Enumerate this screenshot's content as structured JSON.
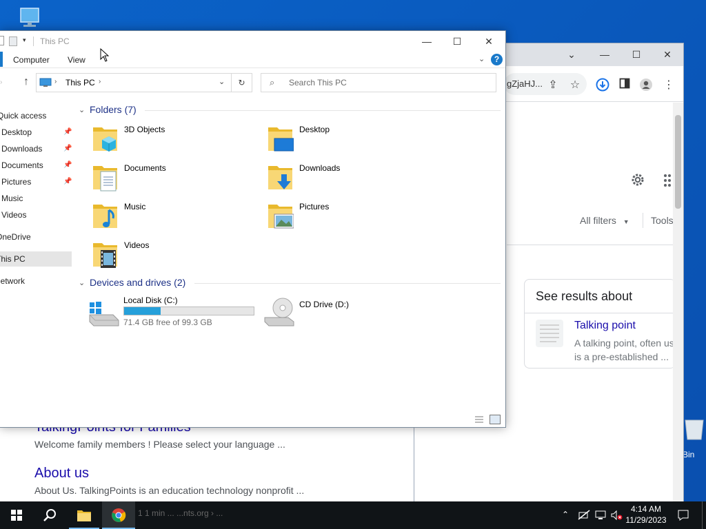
{
  "desktop": {
    "recycle_bin_partial": "Bin"
  },
  "chrome": {
    "address_fragment": "gZjaHJ...",
    "filters": {
      "all_filters": "All filters",
      "tools": "Tools"
    },
    "knowledge_panel": {
      "heading": "See results about",
      "item_title": "Talking point",
      "item_desc_line1": "A talking point, often us",
      "item_desc_line2": "is a pre-established ..."
    },
    "results": [
      {
        "title": "TalkingPoints for Families",
        "snippet": "Welcome family members ! Please select your language ..."
      },
      {
        "title": "About us",
        "snippet": "About Us. TalkingPoints is an education technology nonprofit ..."
      }
    ],
    "partial_bottom_text": "1 1 min ... ...nts.org › ..."
  },
  "explorer": {
    "title": "This PC",
    "ribbon_tabs": [
      "Computer",
      "View"
    ],
    "address": {
      "path": "This PC"
    },
    "search_placeholder": "Search This PC",
    "nav": {
      "quick_access": "Quick access",
      "items": [
        "Desktop",
        "Downloads",
        "Documents",
        "Pictures",
        "Music",
        "Videos"
      ],
      "onedrive": "OneDrive",
      "this_pc": "This PC",
      "network": "Network"
    },
    "folders_header": "Folders (7)",
    "folders": [
      "3D Objects",
      "Desktop",
      "Documents",
      "Downloads",
      "Music",
      "Pictures",
      "Videos"
    ],
    "devices_header": "Devices and drives (2)",
    "drives": [
      {
        "name": "Local Disk (C:)",
        "free_text": "71.4 GB free of 99.3 GB",
        "used_fraction": 0.28
      },
      {
        "name": "CD Drive (D:)"
      }
    ]
  },
  "taskbar": {
    "time": "4:14 AM",
    "date": "11/29/2023"
  },
  "colors": {
    "desktop_blue": "#0b63c9",
    "folder_yellow": "#f4c542",
    "link_blue": "#1a0dab",
    "section_blue": "#1e3287",
    "progress_blue": "#26a0da"
  }
}
